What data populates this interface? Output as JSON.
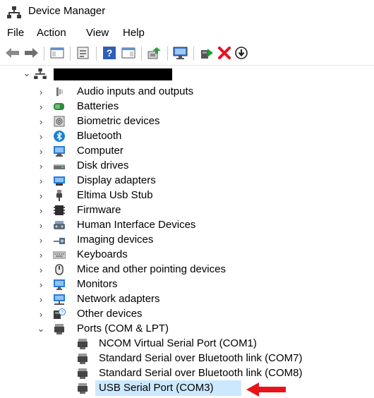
{
  "window": {
    "title": "Device Manager",
    "app_icon": "device-manager-icon"
  },
  "menu": [
    "File",
    "Action",
    "View",
    "Help"
  ],
  "toolbar": [
    {
      "name": "back-icon"
    },
    {
      "name": "forward-icon"
    },
    {
      "name": "show-hide-console-tree-icon"
    },
    {
      "name": "properties-icon"
    },
    {
      "name": "help-icon"
    },
    {
      "name": "action-pane-icon"
    },
    {
      "name": "update-driver-icon"
    },
    {
      "name": "scan-hardware-changes-icon"
    },
    {
      "name": "add-legacy-hardware-icon"
    },
    {
      "name": "uninstall-device-icon"
    },
    {
      "name": "disable-device-icon"
    }
  ],
  "tree": {
    "root_name_redacted": true,
    "categories": [
      {
        "label": "Audio inputs and outputs",
        "icon": "speaker-icon"
      },
      {
        "label": "Batteries",
        "icon": "battery-icon"
      },
      {
        "label": "Biometric devices",
        "icon": "fingerprint-icon"
      },
      {
        "label": "Bluetooth",
        "icon": "bluetooth-icon"
      },
      {
        "label": "Computer",
        "icon": "computer-icon"
      },
      {
        "label": "Disk drives",
        "icon": "disk-drive-icon"
      },
      {
        "label": "Display adapters",
        "icon": "display-adapter-icon"
      },
      {
        "label": "Eltima Usb Stub",
        "icon": "usb-plug-icon"
      },
      {
        "label": "Firmware",
        "icon": "firmware-chip-icon"
      },
      {
        "label": "Human Interface Devices",
        "icon": "hid-icon"
      },
      {
        "label": "Imaging devices",
        "icon": "camera-icon"
      },
      {
        "label": "Keyboards",
        "icon": "keyboard-icon"
      },
      {
        "label": "Mice and other pointing devices",
        "icon": "mouse-icon"
      },
      {
        "label": "Monitors",
        "icon": "monitor-icon"
      },
      {
        "label": "Network adapters",
        "icon": "network-adapter-icon"
      },
      {
        "label": "Other devices",
        "icon": "unknown-device-icon"
      },
      {
        "label": "Ports (COM & LPT)",
        "icon": "port-icon",
        "expanded": true
      }
    ],
    "ports": [
      {
        "label": "NCOM Virtual Serial Port (COM1)",
        "icon": "port-icon"
      },
      {
        "label": "Standard Serial over Bluetooth link (COM7)",
        "icon": "port-icon"
      },
      {
        "label": "Standard Serial over Bluetooth link (COM8)",
        "icon": "port-icon"
      },
      {
        "label": "USB Serial Port (COM3)",
        "icon": "port-icon",
        "selected": true
      }
    ]
  },
  "annotation": {
    "arrow_color": "#e8141a",
    "points_to": "USB Serial Port (COM3)"
  },
  "colors": {
    "selection": "#cce8ff",
    "delete": "#e81123",
    "accent": "#0078d7"
  }
}
